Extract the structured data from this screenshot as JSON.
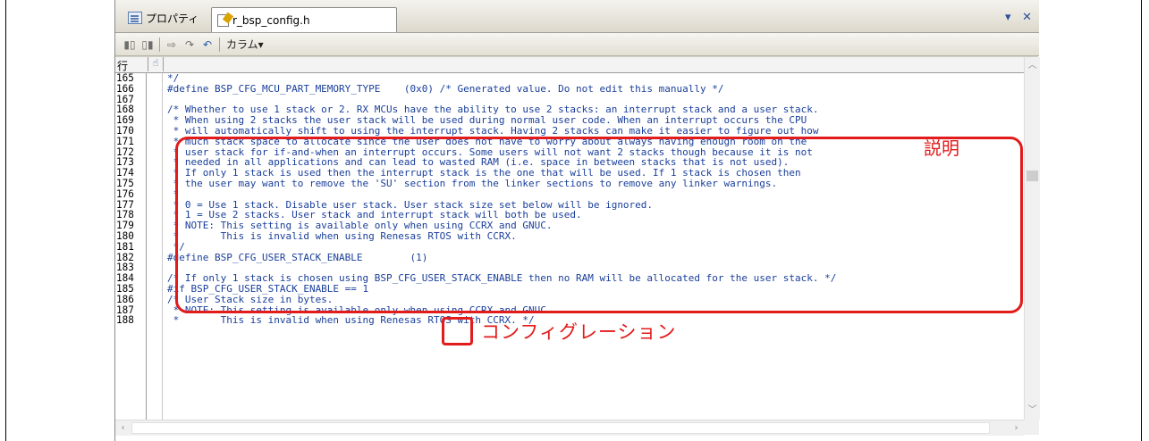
{
  "tabs": {
    "properties_label": "プロパティ",
    "file_label": "r_bsp_config.h"
  },
  "window_controls": {
    "menu": "▾",
    "close": "✕"
  },
  "toolbar": {
    "column_label": "カラム▾"
  },
  "gutter": {
    "line_header": "行"
  },
  "line_numbers": [
    "165",
    "166",
    "167",
    "168",
    "169",
    "170",
    "171",
    "172",
    "173",
    "174",
    "175",
    "176",
    "177",
    "178",
    "179",
    "180",
    "181",
    "182",
    "183",
    "184",
    "185",
    "186",
    "187",
    "188"
  ],
  "code_lines": [
    "*/",
    "#define BSP_CFG_MCU_PART_MEMORY_TYPE    (0x0) /* Generated value. Do not edit this manually */",
    "",
    "/* Whether to use 1 stack or 2. RX MCUs have the ability to use 2 stacks: an interrupt stack and a user stack.",
    " * When using 2 stacks the user stack will be used during normal user code. When an interrupt occurs the CPU",
    " * will automatically shift to using the interrupt stack. Having 2 stacks can make it easier to figure out how",
    " * much stack space to allocate since the user does not have to worry about always having enough room on the",
    " * user stack for if-and-when an interrupt occurs. Some users will not want 2 stacks though because it is not",
    " * needed in all applications and can lead to wasted RAM (i.e. space in between stacks that is not used).",
    " * If only 1 stack is used then the interrupt stack is the one that will be used. If 1 stack is chosen then",
    " * the user may want to remove the 'SU' section from the linker sections to remove any linker warnings.",
    " *",
    " * 0 = Use 1 stack. Disable user stack. User stack size set below will be ignored.",
    " * 1 = Use 2 stacks. User stack and interrupt stack will both be used.",
    " * NOTE: This setting is available only when using CCRX and GNUC.",
    " *       This is invalid when using Renesas RTOS with CCRX.",
    " */",
    "#define BSP_CFG_USER_STACK_ENABLE        (1)",
    "",
    "/* If only 1 stack is chosen using BSP_CFG_USER_STACK_ENABLE then no RAM will be allocated for the user stack. */",
    "#if BSP_CFG_USER_STACK_ENABLE == 1",
    "/* User Stack size in bytes.",
    " * NOTE: This setting is available only when using CCRX and GNUC.",
    " *       This is invalid when using Renesas RTOS with CCRX. */"
  ],
  "annotations": {
    "description_label": "説明",
    "configuration_label": "コンフィグレーション"
  },
  "colors": {
    "annotation_red": "#e21b1b",
    "code_blue": "#1a3f9a"
  }
}
